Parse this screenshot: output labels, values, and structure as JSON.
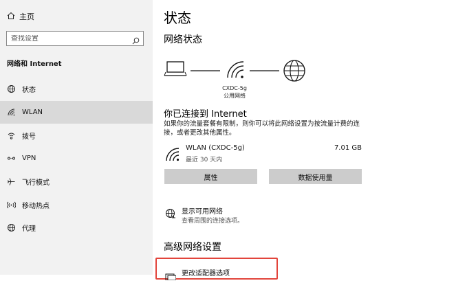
{
  "sidebar": {
    "home_label": "主页",
    "search_placeholder": "查找设置",
    "section_title": "网络和 Internet",
    "items": [
      {
        "label": "状态",
        "icon": "globe-status-icon",
        "active": false
      },
      {
        "label": "WLAN",
        "icon": "wifi-icon",
        "active": true
      },
      {
        "label": "拨号",
        "icon": "dialup-icon",
        "active": false
      },
      {
        "label": "VPN",
        "icon": "vpn-icon",
        "active": false
      },
      {
        "label": "飞行模式",
        "icon": "airplane-icon",
        "active": false
      },
      {
        "label": "移动热点",
        "icon": "hotspot-icon",
        "active": false
      },
      {
        "label": "代理",
        "icon": "proxy-globe-icon",
        "active": false
      }
    ]
  },
  "main": {
    "title": "状态",
    "network_status_heading": "网络状态",
    "ssid": "CXDC-5g",
    "network_type": "公用网络",
    "connected_title": "你已连接到 Internet",
    "description": "如果你的流量套餐有限制，则你可以将此网络设置为按流量计费的连接，或者更改其他属性。",
    "connection": {
      "name": "WLAN (CXDC-5g)",
      "period": "最近 30 天内",
      "usage": "7.01 GB"
    },
    "buttons": {
      "properties": "属性",
      "data_usage": "数据使用量"
    },
    "show_networks": {
      "title": "显示可用网络",
      "subtitle": "查看周围的连接选项。"
    },
    "advanced_heading": "高级网络设置",
    "change_adapter": "更改适配器选项"
  },
  "colors": {
    "sidebar_bg": "#f2f2f2",
    "active_item_bg": "#d9d9d9",
    "button_bg": "#cccccc",
    "highlight_border": "#e2443b"
  }
}
